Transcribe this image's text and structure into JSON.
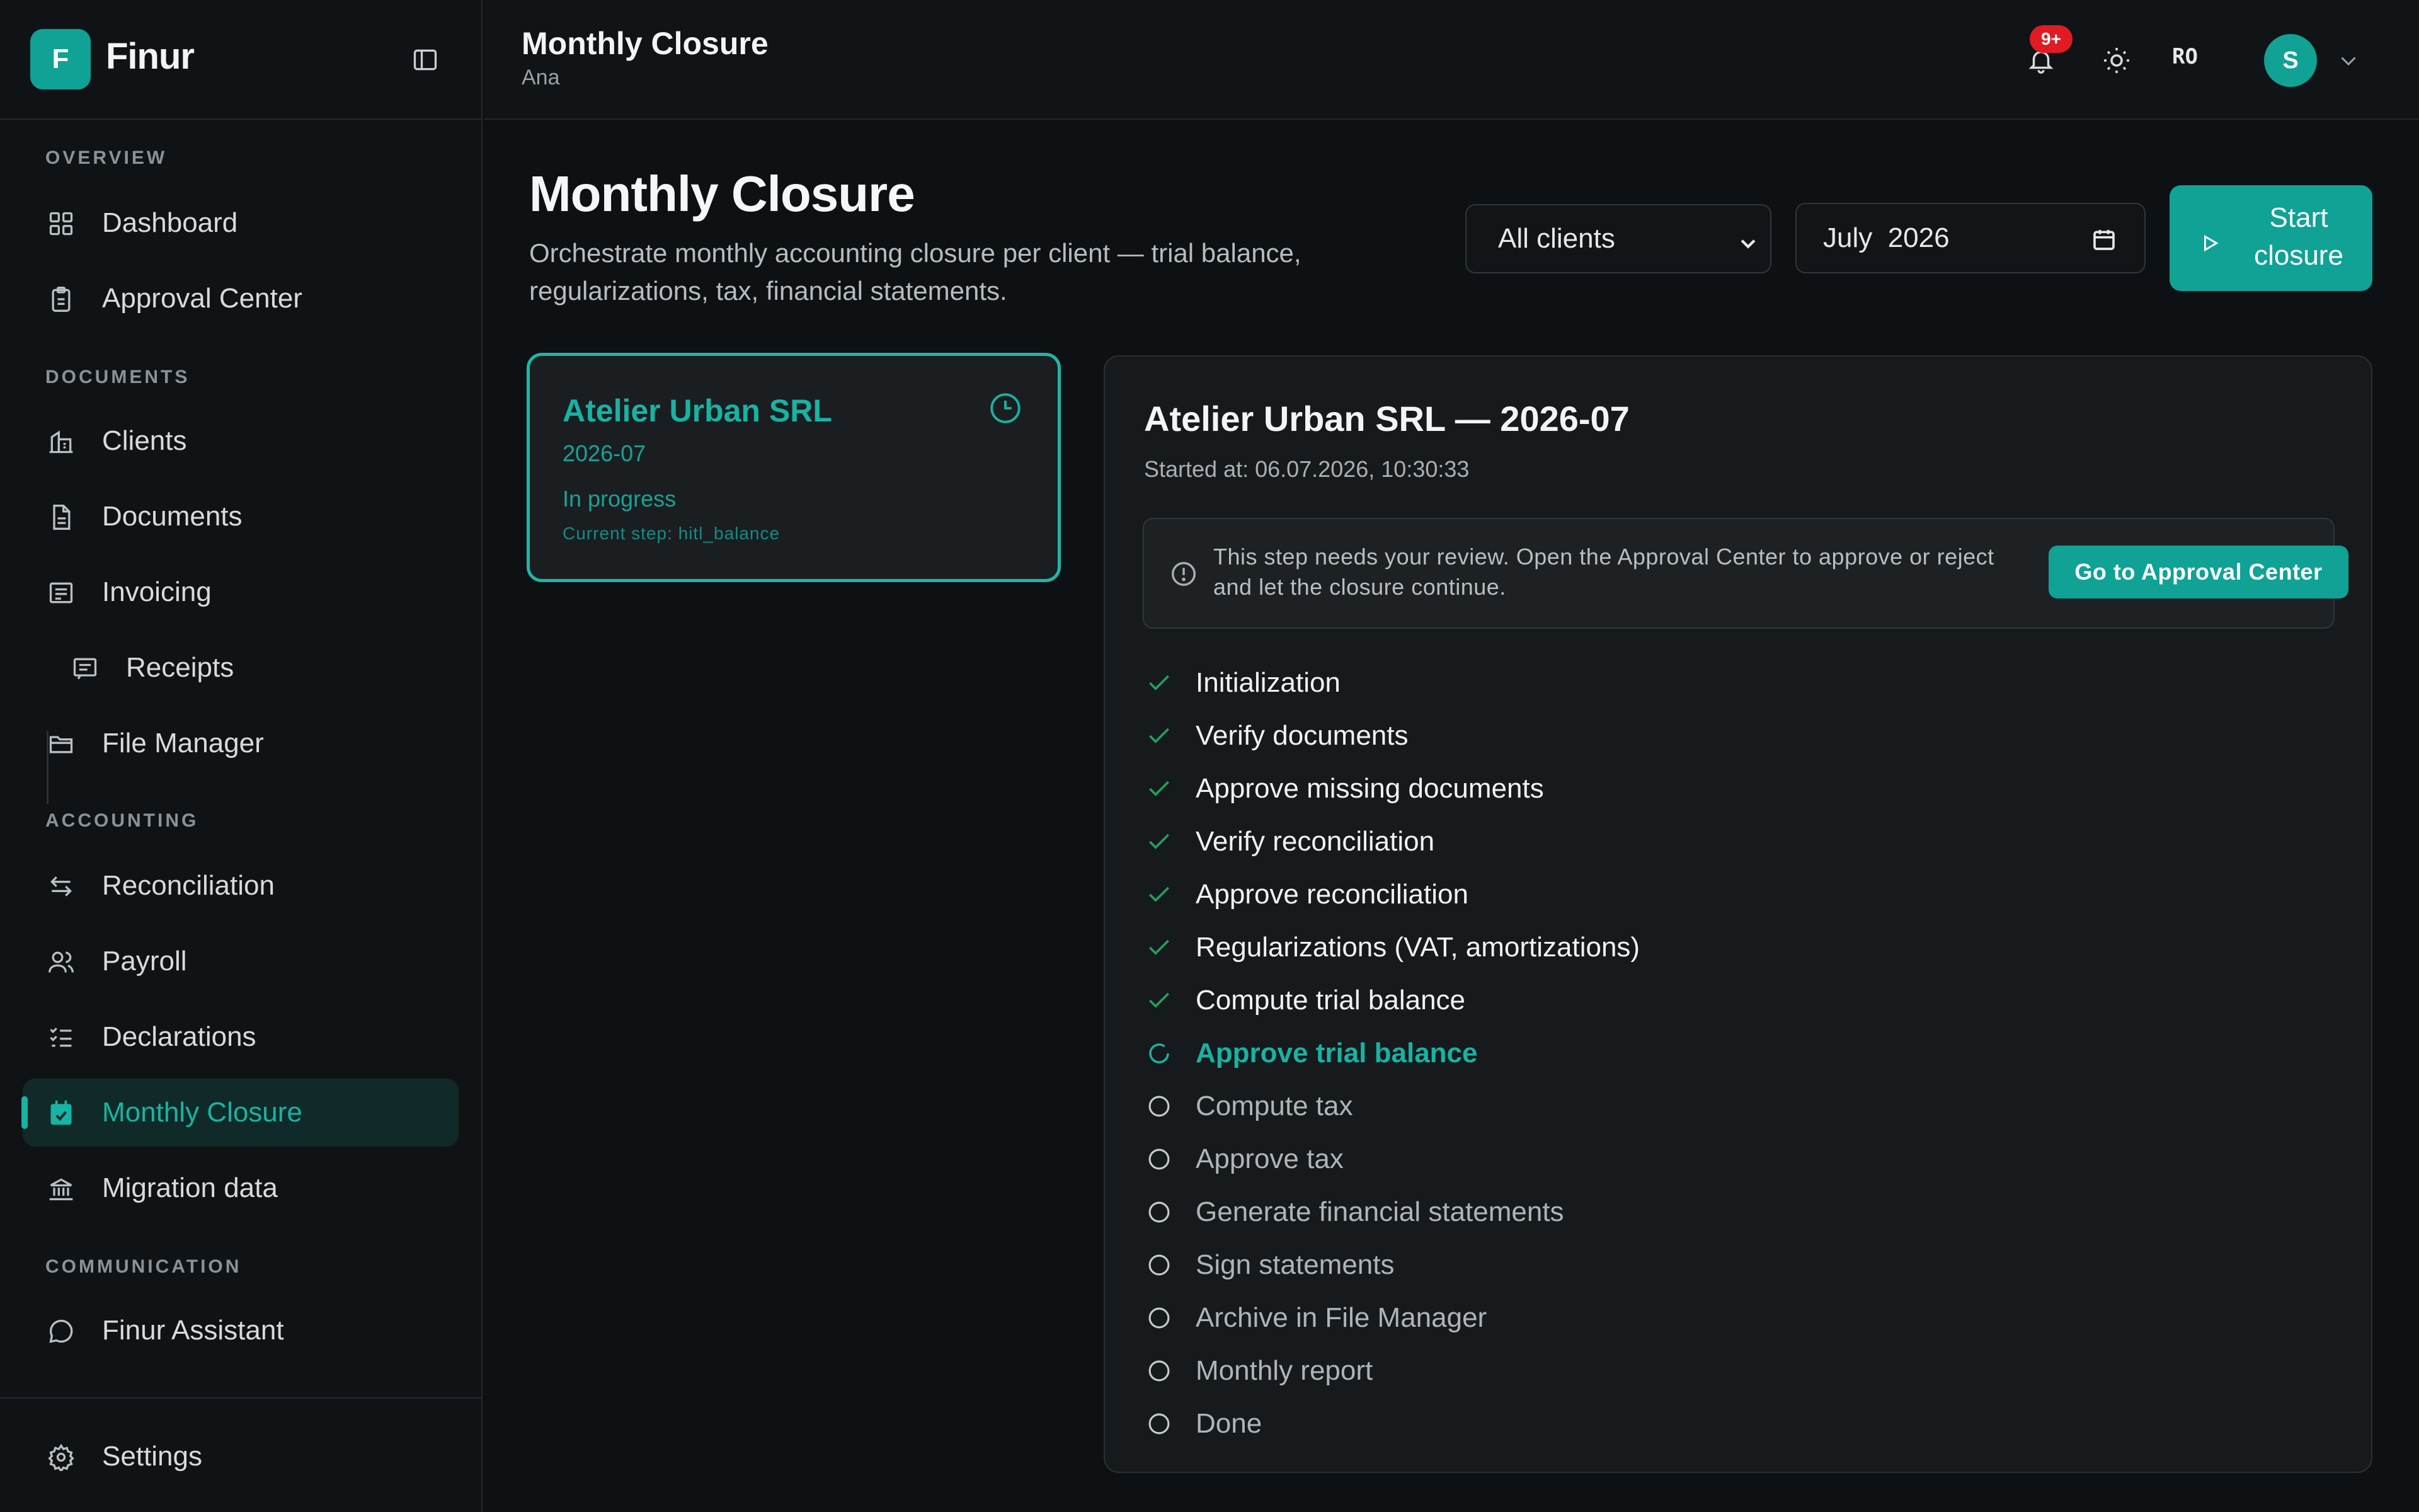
{
  "app": {
    "name": "Finur",
    "logo_letter": "F"
  },
  "sidebar": {
    "sections": [
      "OVERVIEW",
      "DOCUMENTS",
      "ACCOUNTING",
      "COMMUNICATION"
    ],
    "items": [
      {
        "label": "Dashboard",
        "icon": "grid-icon"
      },
      {
        "label": "Approval Center",
        "icon": "clipboard-icon"
      },
      {
        "label": "Clients",
        "icon": "building-icon"
      },
      {
        "label": "Documents",
        "icon": "file-icon"
      },
      {
        "label": "Invoicing",
        "icon": "invoice-icon"
      },
      {
        "label": "Receipts",
        "icon": "receipt-icon"
      },
      {
        "label": "File Manager",
        "icon": "folder-icon"
      },
      {
        "label": "Reconciliation",
        "icon": "arrows-icon"
      },
      {
        "label": "Payroll",
        "icon": "users-icon"
      },
      {
        "label": "Declarations",
        "icon": "checklist-icon"
      },
      {
        "label": "Monthly Closure",
        "icon": "calendar-check-icon"
      },
      {
        "label": "Migration data",
        "icon": "bank-icon"
      },
      {
        "label": "Finur Assistant",
        "icon": "chat-icon"
      }
    ],
    "footer": {
      "label": "Settings",
      "icon": "gear-icon"
    }
  },
  "header": {
    "title": "Monthly Closure",
    "subtitle": "Ana",
    "notifications_badge": "9+",
    "language": "RO",
    "avatar_letter": "S"
  },
  "main": {
    "title": "Monthly Closure",
    "description": "Orchestrate monthly accounting closure per client — trial balance, regularizations, tax, financial statements.",
    "client_filter": "All clients",
    "period": "July  2026",
    "start_button": "Start closure"
  },
  "client_card": {
    "name": "Atelier Urban SRL",
    "period": "2026-07",
    "status": "In progress",
    "current_step": "Current step: hitl_balance"
  },
  "detail": {
    "title": "Atelier Urban SRL — 2026-07",
    "started": "Started at: 06.07.2026, 10:30:33",
    "review_message": "This step needs your review. Open the Approval Center to approve or reject and let the closure continue.",
    "review_button": "Go to Approval Center",
    "steps": [
      {
        "label": "Initialization",
        "state": "done"
      },
      {
        "label": "Verify documents",
        "state": "done"
      },
      {
        "label": "Approve missing documents",
        "state": "done"
      },
      {
        "label": "Verify reconciliation",
        "state": "done"
      },
      {
        "label": "Approve reconciliation",
        "state": "done"
      },
      {
        "label": "Regularizations (VAT, amortizations)",
        "state": "done"
      },
      {
        "label": "Compute trial balance",
        "state": "done"
      },
      {
        "label": "Approve trial balance",
        "state": "current"
      },
      {
        "label": "Compute tax",
        "state": "pending"
      },
      {
        "label": "Approve tax",
        "state": "pending"
      },
      {
        "label": "Generate financial statements",
        "state": "pending"
      },
      {
        "label": "Sign statements",
        "state": "pending"
      },
      {
        "label": "Archive in File Manager",
        "state": "pending"
      },
      {
        "label": "Monthly report",
        "state": "pending"
      },
      {
        "label": "Done",
        "state": "pending"
      }
    ]
  },
  "colors": {
    "accent": "#0fa295",
    "accent_text": "#17b3a3",
    "done_check": "#22a05c",
    "badge": "#e01b24"
  }
}
